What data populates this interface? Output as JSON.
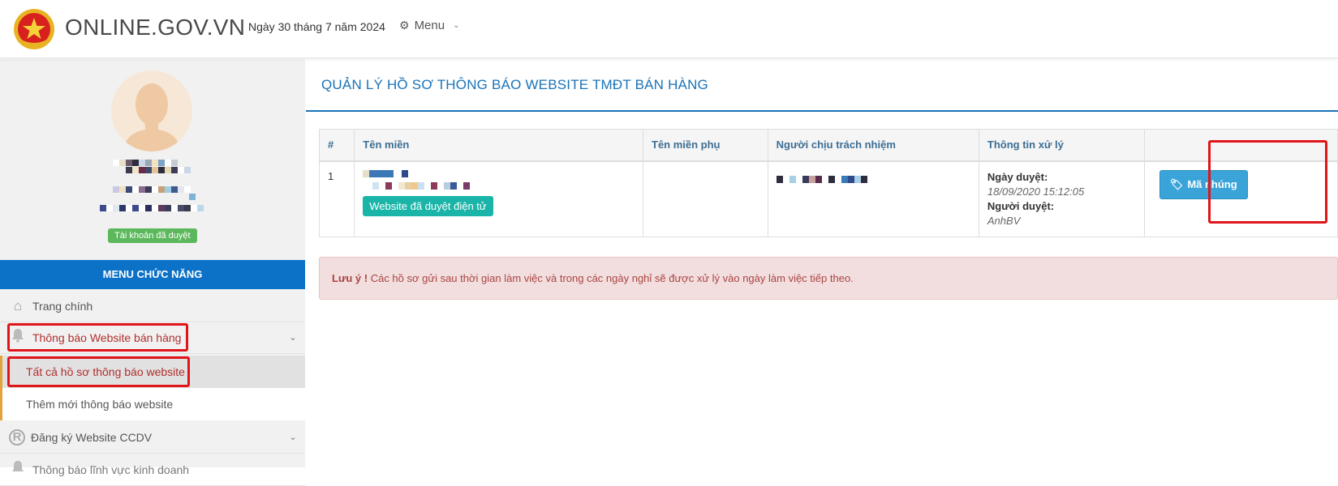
{
  "header": {
    "brand": "ONLINE.GOV.VN",
    "date": "Ngày 30 tháng 7 năm 2024",
    "menu_label": "Menu",
    "menu_icon": "gear-icon"
  },
  "sidebar": {
    "account_badge": "Tài khoản đã duyệt",
    "menu_title": "MENU CHỨC NĂNG",
    "items": [
      {
        "label": "Trang chính",
        "icon": "home-icon"
      },
      {
        "label": "Thông báo Website bán hàng",
        "icon": "bell-icon"
      },
      {
        "label": "Tất cả hồ sơ thông báo website"
      },
      {
        "label": "Thêm mới thông báo website"
      },
      {
        "label": "Đăng ký Website CCDV",
        "icon": "registered-icon"
      },
      {
        "label": "Thông báo lĩnh vực kinh doanh",
        "icon": "bell-icon"
      }
    ]
  },
  "main": {
    "title": "QUẢN LÝ HỒ SƠ THÔNG BÁO WEBSITE TMĐT BÁN HÀNG",
    "table": {
      "headers": [
        "#",
        "Tên miền",
        "Tên miền phụ",
        "Người chịu trách nhiệm",
        "Thông tin xử lý",
        ""
      ],
      "rows": [
        {
          "index": "1",
          "status_badge": "Website đã duyệt điện tử",
          "approved_date_label": "Ngày duyệt:",
          "approved_date": "18/09/2020 15:12:05",
          "approver_label": "Người duyệt:",
          "approver": "AnhBV",
          "embed_button": "Mã nhúng"
        }
      ]
    },
    "notice": {
      "prefix": "Lưu ý !",
      "text": "Các hồ sơ gửi sau thời gian làm việc và trong các ngày nghỉ sẽ được xử lý vào ngày làm việc tiếp theo."
    }
  },
  "colors": {
    "primary_blue": "#0b72c7",
    "title_blue": "#1a73b8",
    "success_green": "#5cb85c",
    "teal_badge": "#1ab5a8",
    "embed_button": "#3aa4d9",
    "alert_bg": "#f2dede",
    "alert_text": "#a94442",
    "annotation_red": "#e0151a"
  }
}
